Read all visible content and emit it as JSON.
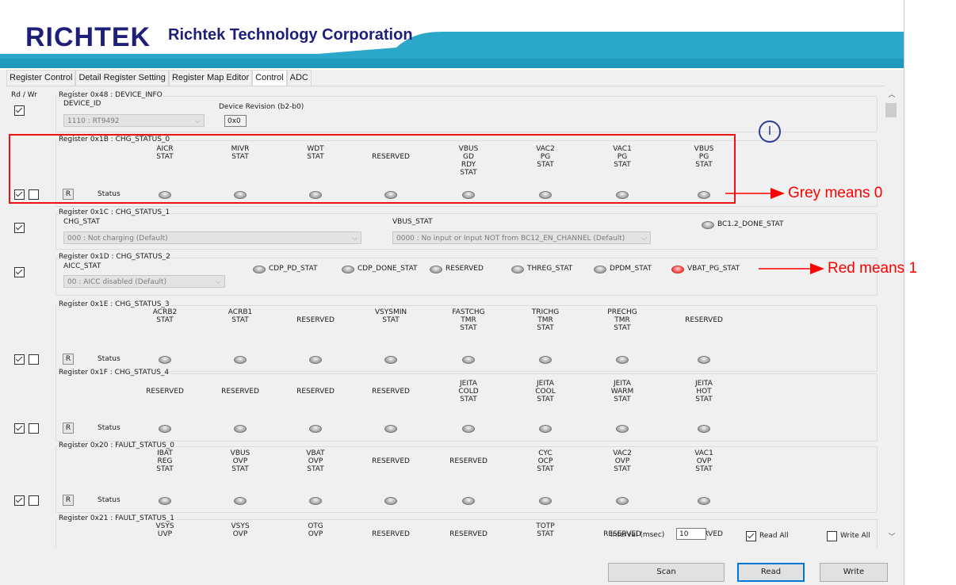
{
  "header": {
    "logo_text": "RICHTEK",
    "company_name": "Richtek Technology Corporation",
    "band_color": "#2aa7c9"
  },
  "tabs": [
    "Register Control",
    "Detail Register Setting",
    "Register Map Editor",
    "Control",
    "ADC"
  ],
  "active_tab": "Control",
  "rw_header": "Rd  /  Wr",
  "status_label": "Status",
  "r_button": "R",
  "device_info": {
    "title": "Register 0x48 : DEVICE_INFO",
    "field_label": "DEVICE_ID",
    "combo_value": "1110 : RT9492",
    "revision_label": "Device Revision (b2-b0)",
    "revision_value": "0x0"
  },
  "chg_status_0": {
    "title": "Register 0x1B : CHG_STATUS_0",
    "columns": [
      {
        "label": "AICR\nSTAT",
        "state": 0
      },
      {
        "label": "MIVR\nSTAT",
        "state": 0
      },
      {
        "label": "WDT\nSTAT",
        "state": 0
      },
      {
        "label": "RESERVED",
        "state": 0
      },
      {
        "label": "VBUS\nGD\nRDY\nSTAT",
        "state": 0
      },
      {
        "label": "VAC2\nPG\nSTAT",
        "state": 0
      },
      {
        "label": "VAC1\nPG\nSTAT",
        "state": 0
      },
      {
        "label": "VBUS\nPG\nSTAT",
        "state": 0
      }
    ]
  },
  "chg_status_1": {
    "title": "Register 0x1C : CHG_STATUS_1",
    "chg_stat_label": "CHG_STAT",
    "chg_stat_value": "000 : Not charging (Default)",
    "vbus_stat_label": "VBUS_STAT",
    "vbus_stat_value": "0000 : No input or Input NOT from BC12_EN_CHANNEL (Default)",
    "bc12_label": "BC1.2_DONE_STAT",
    "bc12_state": 0
  },
  "chg_status_2": {
    "title": "Register 0x1D : CHG_STATUS_2",
    "aicc_label": "AICC_STAT",
    "aicc_value": "00 : AICC disabled (Default)",
    "indicators": [
      {
        "label": "CDP_PD_STAT",
        "state": 0
      },
      {
        "label": "CDP_DONE_STAT",
        "state": 0
      },
      {
        "label": "RESERVED",
        "state": 0
      },
      {
        "label": "THREG_STAT",
        "state": 0
      },
      {
        "label": "DPDM_STAT",
        "state": 0
      },
      {
        "label": "VBAT_PG_STAT",
        "state": 1
      }
    ]
  },
  "chg_status_3": {
    "title": "Register 0x1E : CHG_STATUS_3",
    "columns": [
      {
        "label": "ACRB2\nSTAT",
        "state": 0
      },
      {
        "label": "ACRB1\nSTAT",
        "state": 0
      },
      {
        "label": "RESERVED",
        "state": 0
      },
      {
        "label": "VSYSMIN\nSTAT",
        "state": 0
      },
      {
        "label": "FASTCHG\nTMR\nSTAT",
        "state": 0
      },
      {
        "label": "TRICHG\nTMR\nSTAT",
        "state": 0
      },
      {
        "label": "PRECHG\nTMR\nSTAT",
        "state": 0
      },
      {
        "label": "RESERVED",
        "state": 0
      }
    ]
  },
  "chg_status_4": {
    "title": "Register 0x1F : CHG_STATUS_4",
    "columns": [
      {
        "label": "RESERVED",
        "state": 0
      },
      {
        "label": "RESERVED",
        "state": 0
      },
      {
        "label": "RESERVED",
        "state": 0
      },
      {
        "label": "RESERVED",
        "state": 0
      },
      {
        "label": "JEITA\nCOLD\nSTAT",
        "state": 0
      },
      {
        "label": "JEITA\nCOOL\nSTAT",
        "state": 0
      },
      {
        "label": "JEITA\nWARM\nSTAT",
        "state": 0
      },
      {
        "label": "JEITA\nHOT\nSTAT",
        "state": 0
      }
    ]
  },
  "fault_status_0": {
    "title": "Register 0x20 : FAULT_STATUS_0",
    "columns": [
      {
        "label": "IBAT\nREG\nSTAT",
        "state": 0
      },
      {
        "label": "VBUS\nOVP\nSTAT",
        "state": 0
      },
      {
        "label": "VBAT\nOVP\nSTAT",
        "state": 0
      },
      {
        "label": "RESERVED",
        "state": 0
      },
      {
        "label": "RESERVED",
        "state": 0
      },
      {
        "label": "CYC\nOCP\nSTAT",
        "state": 0
      },
      {
        "label": "VAC2\nOVP\nSTAT",
        "state": 0
      },
      {
        "label": "VAC1\nOVP\nSTAT",
        "state": 0
      }
    ]
  },
  "fault_status_1": {
    "title": "Register 0x21 : FAULT_STATUS_1",
    "columns": [
      {
        "label": "VSYS\nUVP",
        "state": 0
      },
      {
        "label": "VSYS\nOVP",
        "state": 0
      },
      {
        "label": "OTG\nOVP",
        "state": 0
      },
      {
        "label": "RESERVED",
        "state": 0
      },
      {
        "label": "RESERVED",
        "state": 0
      },
      {
        "label": "TOTP\nSTAT",
        "state": 0
      },
      {
        "label": "RESERVED",
        "state": 0
      },
      {
        "label": "RESERVED",
        "state": 0
      }
    ]
  },
  "footer": {
    "interval_label": "Interval (msec)",
    "interval_value": "10",
    "read_all_label": "Read All",
    "read_all_checked": true,
    "write_all_label": "Write All",
    "write_all_checked": false,
    "scan_label": "Scan",
    "read_label": "Read",
    "write_label": "Write"
  },
  "annotations": {
    "grey_text": "Grey means 0",
    "red_text": "Red means 1",
    "circle_text": "I",
    "color": "#ff0000"
  }
}
